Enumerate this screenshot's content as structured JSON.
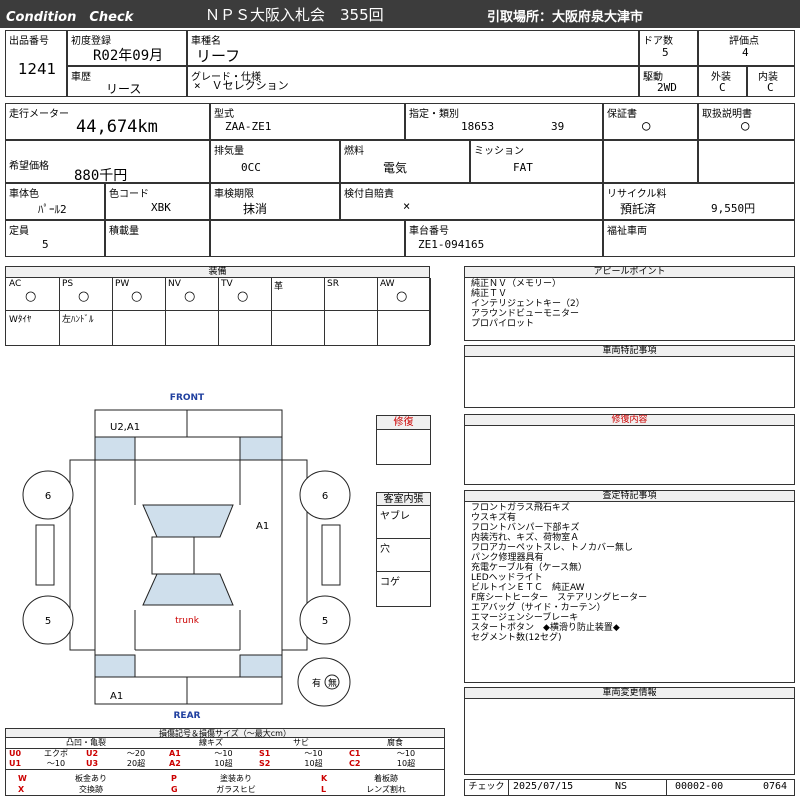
{
  "header": {
    "left": "Condition　Check",
    "center": "ＮＰＳ大阪入札会　355回",
    "right": "引取場所：大阪府泉大津市"
  },
  "labels": {
    "lot": "出品番号",
    "first_reg": "初度登録",
    "model_name": "車種名",
    "doors": "ドア数",
    "grade_score": "評価点",
    "history": "車歴",
    "grade": "グレード・仕様",
    "drive": "駆動",
    "ext": "外装",
    "int": "内装",
    "odo": "走行メーター",
    "chassis": "型式",
    "designation": "指定・類別",
    "warranty": "保証書",
    "manual": "取扱説明書",
    "price": "希望価格",
    "disp": "排気量",
    "fuel": "燃料",
    "mission": "ミッション",
    "color": "車体色",
    "color_code": "色コード",
    "inspection": "車検期限",
    "insurance": "検付自賠責",
    "recycle": "リサイクル料",
    "capacity": "定員",
    "load": "積載量",
    "chassis_no": "車台番号",
    "welfare": "福祉車両"
  },
  "vehicle": {
    "lot": "1241",
    "first_reg": "R02年09月",
    "model_name": "リーフ",
    "doors": "5",
    "score": "4",
    "history": "リース",
    "grade": "×　Ｖセレクション",
    "drive": "2WD",
    "ext": "C",
    "int": "C",
    "odo": "44,674km",
    "chassis": "ZAA-ZE1",
    "designation": "18653",
    "category": "39",
    "warranty": "○",
    "manual": "○",
    "price": "880千円",
    "disp": "0CC",
    "fuel": "電気",
    "mission": "FAT",
    "color": "ﾊﾟｰﾙ2",
    "color_code": "XBK",
    "inspection": "抹消",
    "insurance": "×",
    "recycle_status": "預託済",
    "recycle_fee": "9,550円",
    "capacity": "5",
    "chassis_no": "ZE1-094165"
  },
  "equipment": {
    "title": "装備",
    "cols": [
      {
        "name": "AC",
        "val": "○"
      },
      {
        "name": "PS",
        "val": "○"
      },
      {
        "name": "PW",
        "val": "○"
      },
      {
        "name": "NV",
        "val": "○"
      },
      {
        "name": "TV",
        "val": "○"
      },
      {
        "name": "革",
        "val": ""
      },
      {
        "name": "SR",
        "val": ""
      },
      {
        "name": "AW",
        "val": "○"
      }
    ],
    "row2": [
      "Wﾀｲﾔ",
      "左ﾊﾝﾄﾞﾙ",
      "",
      "",
      "",
      "",
      "",
      ""
    ]
  },
  "diagram": {
    "front": "FRONT",
    "rear": "REAR",
    "trunk": "trunk",
    "tl": "6",
    "tr": "6",
    "bl": "5",
    "br": "5",
    "top_marks": "U2,A1",
    "right_mark": "A1",
    "bottom_mark": "A1",
    "has_label": "有",
    "no_label": "無"
  },
  "repair": {
    "title": "修復"
  },
  "interior": {
    "title": "客室内張",
    "items": [
      "ヤブレ",
      "穴",
      "コゲ"
    ]
  },
  "appeal": {
    "title": "アピールポイント",
    "lines": [
      "純正ＮＶ（メモリー）",
      "純正ＴＶ",
      "インテリジェントキー（2）",
      "アラウンドビューモニター",
      "プロパイロット"
    ]
  },
  "special": {
    "title": "車両特記事項"
  },
  "repair_detail": {
    "title": "修復内容"
  },
  "inspect": {
    "title": "査定特記事項",
    "lines": [
      "フロントガラス飛石キズ",
      "ウスキズ有",
      "フロントバンパー下部キズ",
      "内装汚れ、キズ、荷物室Ａ",
      "フロアカーペットスレ、トノカバー無し",
      "パンク修理器具有",
      "充電ケーブル有（ケース無）",
      "LEDヘッドライト",
      "ビルトインＥＴＣ　純正AW",
      "F席シートヒーター　ステアリングヒーター",
      "エアバッグ（サイド・カーテン）",
      "エマージェンシーブレーキ",
      "スタートボタン　◆横滑り防止装置◆",
      "セグメント数(12セグ)"
    ]
  },
  "changes": {
    "title": "車両変更情報"
  },
  "legend": {
    "title": "損傷記号＆損傷サイズ（～最大cm）",
    "groups": [
      {
        "name": "凸凹・亀裂",
        "rows": [
          [
            "U0",
            "エクボ",
            "U2",
            "～20"
          ],
          [
            "U1",
            "～10",
            "U3",
            "20超"
          ]
        ]
      },
      {
        "name": "線キズ",
        "rows": [
          [
            "A1",
            "～10"
          ],
          [
            "A2",
            "10超"
          ]
        ]
      },
      {
        "name": "サビ",
        "rows": [
          [
            "S1",
            "～10"
          ],
          [
            "S2",
            "10超"
          ]
        ]
      },
      {
        "name": "腐食",
        "rows": [
          [
            "C1",
            "～10"
          ],
          [
            "C2",
            "10超"
          ]
        ]
      }
    ],
    "bottom": [
      [
        "W",
        "板金あり",
        "P",
        "塗装あり",
        "K",
        "着板跡"
      ],
      [
        "X",
        "交換跡",
        "G",
        "ガラスヒビ",
        "L",
        "レンズ割れ"
      ]
    ]
  },
  "footer": {
    "check_label": "チェック",
    "date": "2025/07/15",
    "inspector": "NS",
    "code": "00002-00",
    "num": "0764"
  },
  "colors": {
    "header_bg": "#3c3c3c",
    "red": "#cc0000",
    "blue": "#1f3f9f",
    "panel": "#cfdfec"
  }
}
